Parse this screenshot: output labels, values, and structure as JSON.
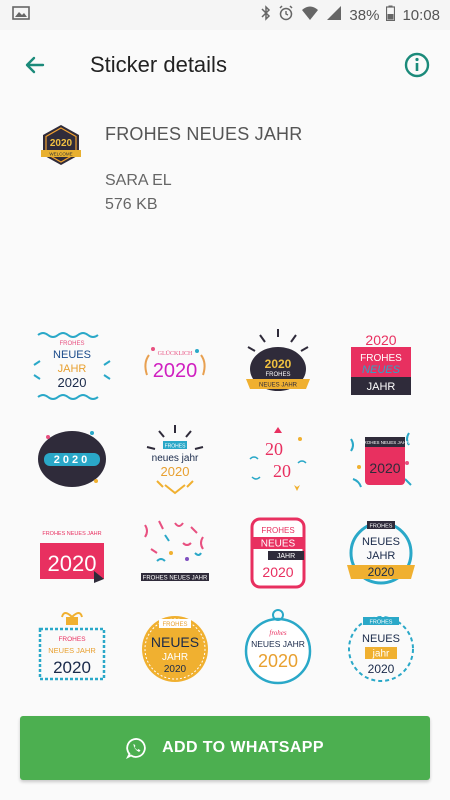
{
  "status_bar": {
    "battery": "38%",
    "time": "10:08"
  },
  "app_bar": {
    "title": "Sticker details"
  },
  "pack": {
    "name": "FROHES NEUES JAHR",
    "author": "SARA EL",
    "size": "576 KB",
    "tray_year": "2020",
    "tray_sub": "WELCOME"
  },
  "stickers": [
    {
      "lines": [
        "FROHES",
        "NEUES",
        "JAHR",
        "2020"
      ]
    },
    {
      "lines": [
        "GLÜCKLICH",
        "2020"
      ]
    },
    {
      "lines": [
        "2020",
        "FROHES",
        "NEUES JAHR"
      ]
    },
    {
      "lines": [
        "2020",
        "FROHES",
        "NEUES",
        "JAHR"
      ]
    },
    {
      "lines": [
        "2020"
      ]
    },
    {
      "lines": [
        "FROHES",
        "neues jahr",
        "2020"
      ]
    },
    {
      "lines": [
        "20",
        "20"
      ]
    },
    {
      "lines": [
        "FROHES NEUES JAHR",
        "2020"
      ]
    },
    {
      "lines": [
        "FROHES NEUES JAHR",
        "2020"
      ]
    },
    {
      "lines": [
        "FROHES NEUES JAHR"
      ]
    },
    {
      "lines": [
        "FROHES",
        "NEUES",
        "JAHR",
        "2020"
      ]
    },
    {
      "lines": [
        "FROHES",
        "NEUES",
        "JAHR",
        "2020"
      ]
    },
    {
      "lines": [
        "FROHES",
        "NEUES JAHR",
        "2020"
      ]
    },
    {
      "lines": [
        "FROHES",
        "NEUES",
        "JAHR",
        "2020"
      ]
    },
    {
      "lines": [
        "frohes",
        "NEUES JAHR",
        "2020"
      ]
    },
    {
      "lines": [
        "FROHES",
        "NEUES",
        "jahr",
        "2020"
      ]
    }
  ],
  "add_button": {
    "label": "ADD TO WHATSAPP"
  },
  "colors": {
    "accent": "#1b8a7a",
    "button": "#4caf50"
  }
}
